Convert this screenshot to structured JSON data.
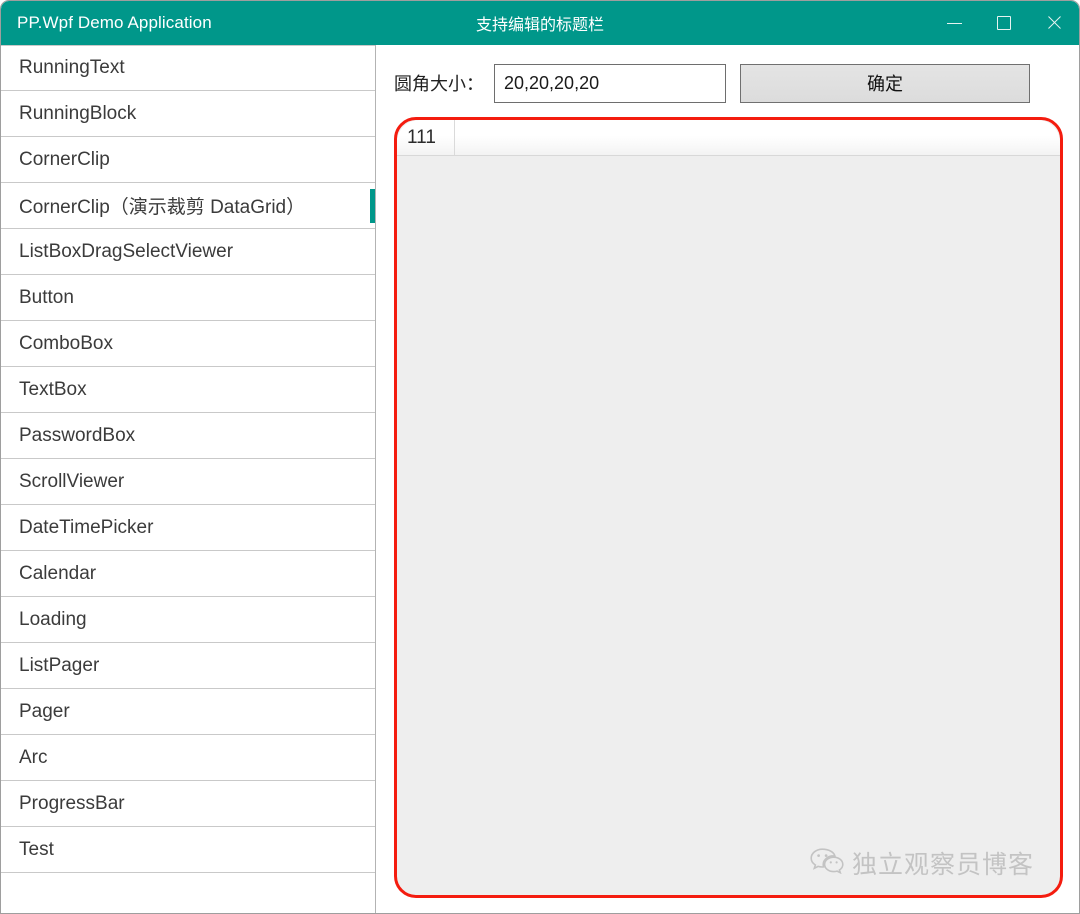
{
  "window": {
    "app_title": "PP.Wpf Demo Application",
    "center_title": "支持编辑的标题栏",
    "accent_color": "#00978a",
    "controls": {
      "minimize_name": "minimize",
      "maximize_name": "maximize",
      "close_name": "close"
    }
  },
  "sidebar": {
    "items": [
      {
        "label": "RunningText",
        "selected": false
      },
      {
        "label": "RunningBlock",
        "selected": false
      },
      {
        "label": "CornerClip",
        "selected": false
      },
      {
        "label": "CornerClip（演示裁剪 DataGrid）",
        "selected": true
      },
      {
        "label": "ListBoxDragSelectViewer",
        "selected": false
      },
      {
        "label": "Button",
        "selected": false
      },
      {
        "label": "ComboBox",
        "selected": false
      },
      {
        "label": "TextBox",
        "selected": false
      },
      {
        "label": "PasswordBox",
        "selected": false
      },
      {
        "label": "ScrollViewer",
        "selected": false
      },
      {
        "label": "DateTimePicker",
        "selected": false
      },
      {
        "label": "Calendar",
        "selected": false
      },
      {
        "label": "Loading",
        "selected": false
      },
      {
        "label": "ListPager",
        "selected": false
      },
      {
        "label": "Pager",
        "selected": false
      },
      {
        "label": "Arc",
        "selected": false
      },
      {
        "label": "ProgressBar",
        "selected": false
      },
      {
        "label": "Test",
        "selected": false
      },
      {
        "label": "",
        "selected": false
      }
    ]
  },
  "content": {
    "toolbar": {
      "corner_label": "圆角大小：",
      "corner_value": "20,20,20,20",
      "corner_placeholder": "20,20,20,20",
      "confirm_label": "确定"
    },
    "grid": {
      "clip_border_color": "#f41c0f",
      "corner_radius": "20,20,20,20",
      "columns": [
        "111"
      ],
      "rows": []
    },
    "watermark": {
      "text": "独立观察员博客",
      "icon": "wechat-icon"
    }
  }
}
